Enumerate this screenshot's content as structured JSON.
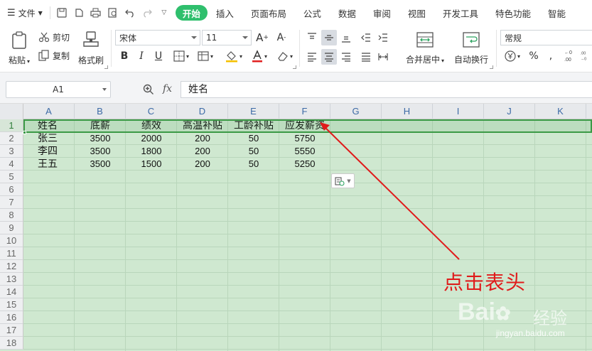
{
  "menubar": {
    "file_label": "文件",
    "tabs": [
      {
        "label": "开始",
        "active": true
      },
      {
        "label": "插入"
      },
      {
        "label": "页面布局"
      },
      {
        "label": "公式"
      },
      {
        "label": "数据"
      },
      {
        "label": "审阅"
      },
      {
        "label": "视图"
      },
      {
        "label": "开发工具"
      },
      {
        "label": "特色功能"
      },
      {
        "label": "智能"
      }
    ],
    "active_color": "#2fbf6d"
  },
  "ribbon": {
    "paste": "粘贴",
    "cut": "剪切",
    "copy": "复制",
    "format_painter": "格式刷",
    "font_name": "宋体",
    "font_size": "11",
    "merge_center": "合并居中",
    "wrap_text": "自动换行",
    "number_format": "常规",
    "percent": "%"
  },
  "formula_bar": {
    "name_box": "A1",
    "fx": "fx",
    "value": "姓名"
  },
  "grid": {
    "columns": [
      "A",
      "B",
      "C",
      "D",
      "E",
      "F",
      "G",
      "H",
      "I",
      "J",
      "K"
    ],
    "rows": [
      "1",
      "2",
      "3",
      "4",
      "5",
      "6",
      "7",
      "8",
      "9",
      "10",
      "11",
      "12",
      "13",
      "14",
      "15",
      "16",
      "17",
      "18"
    ],
    "header": [
      "姓名",
      "底薪",
      "绩效",
      "高温补贴",
      "工龄补贴",
      "应发薪资"
    ],
    "data": [
      [
        "张三",
        "3500",
        "2000",
        "200",
        "50",
        "5750"
      ],
      [
        "李四",
        "3500",
        "1800",
        "200",
        "50",
        "5550"
      ],
      [
        "王五",
        "3500",
        "1500",
        "200",
        "50",
        "5250"
      ]
    ]
  },
  "annotation": {
    "text": "点击表头",
    "color": "#e01b1b"
  },
  "watermark": {
    "logo": "Bai",
    "suffix": "经验",
    "url": "jingyan.baidu.com"
  }
}
